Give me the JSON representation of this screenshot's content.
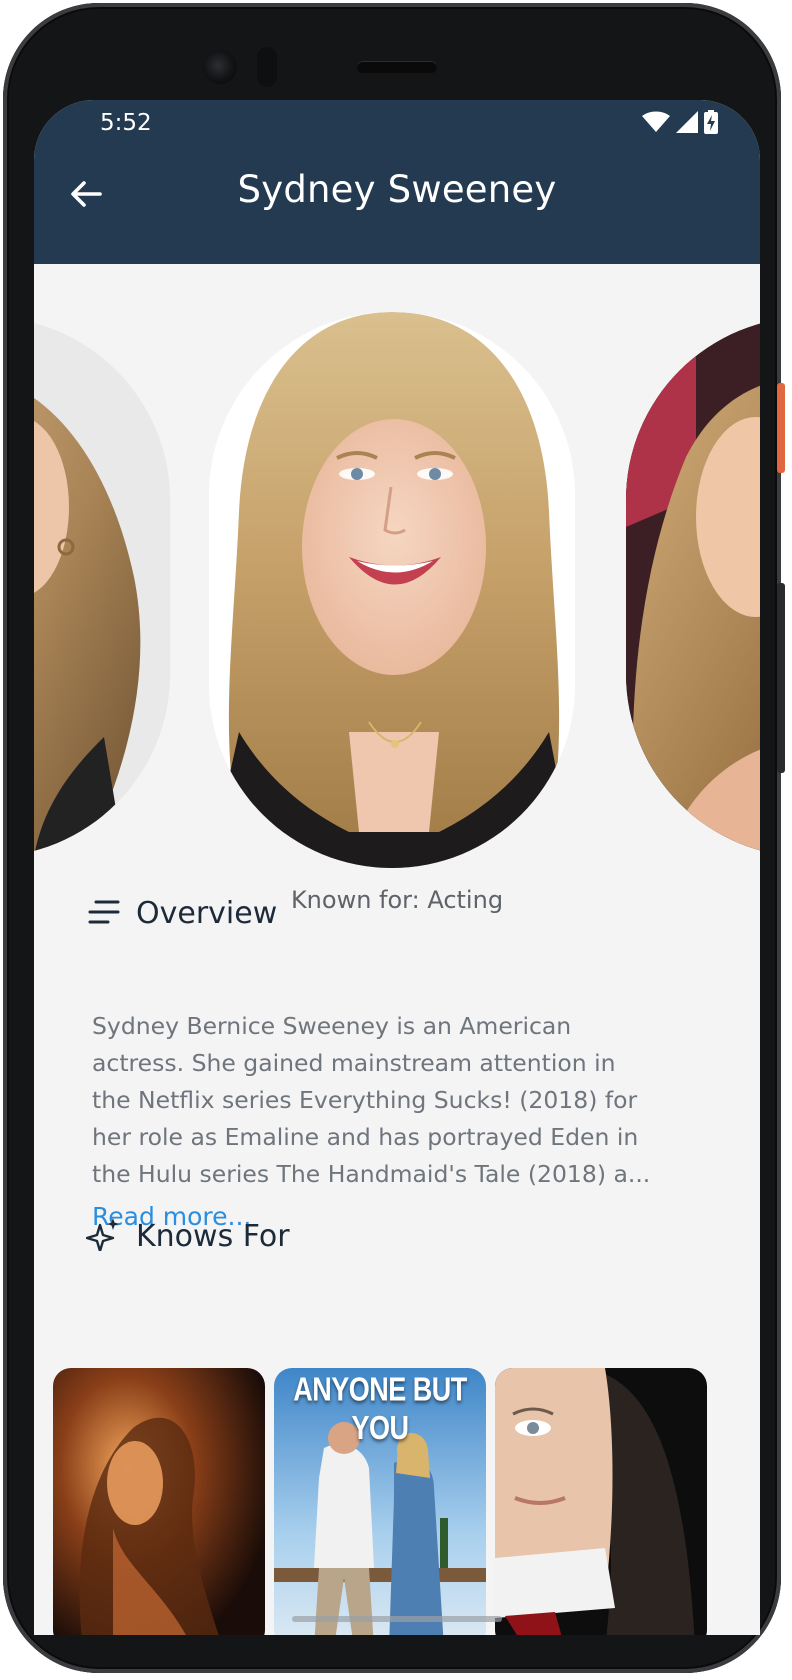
{
  "status_bar": {
    "time": "5:52"
  },
  "header": {
    "title": "Sydney Sweeney"
  },
  "profile": {
    "known_for": "Known for: Acting"
  },
  "overview": {
    "title": "Overview",
    "lines": [
      "Sydney Bernice Sweeney is an American",
      "actress. She gained mainstream attention in",
      "the Netflix series Everything Sucks! (2018) for",
      "her role as Emaline and has portrayed Eden in",
      "the Hulu series The Handmaid's Tale (2018) a..."
    ],
    "read_more": "Read more..."
  },
  "knows_for": {
    "title": "Knows For",
    "posters": [
      {
        "title": ""
      },
      {
        "title": "ANYONE BUT YOU"
      },
      {
        "title": ""
      }
    ]
  },
  "colors": {
    "header_bg": "#243a51",
    "screen_bg": "#f4f4f5",
    "link": "#2a8ee0"
  },
  "icons": {
    "back": "arrow-left-icon",
    "wifi": "wifi-icon",
    "signal": "signal-icon",
    "battery": "battery-charging-icon",
    "overview": "menu-lines-icon",
    "knows_for": "sparkles-icon"
  }
}
